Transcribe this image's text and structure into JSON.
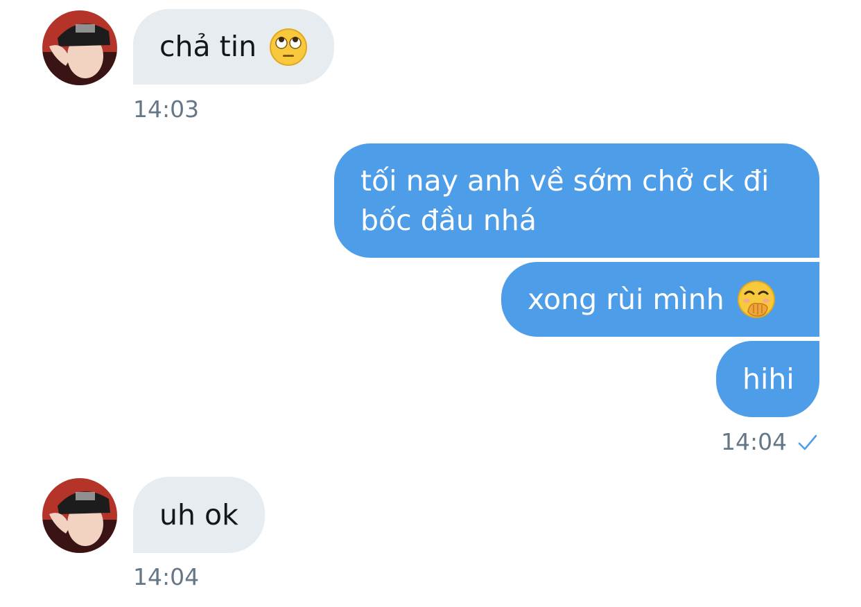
{
  "messages": [
    {
      "sender": "other",
      "text": "chả tin",
      "emoji": "face-with-rolling-eyes",
      "time": "14:03"
    },
    {
      "sender": "me",
      "text_line1": "tối nay anh về sớm chở ck đi",
      "text_line2": "bốc đầu nhá"
    },
    {
      "sender": "me",
      "text": "xong rùi mình",
      "emoji": "face-with-hand-over-mouth"
    },
    {
      "sender": "me",
      "text": "hihi",
      "time": "14:04",
      "status": "sent-check-icon"
    },
    {
      "sender": "other",
      "text": "uh ok",
      "time": "14:04"
    }
  ],
  "colors": {
    "incoming_bubble": "#e6ecf0",
    "outgoing_bubble": "#4d9de8",
    "timestamp": "#657786",
    "check": "#4d9de8"
  }
}
